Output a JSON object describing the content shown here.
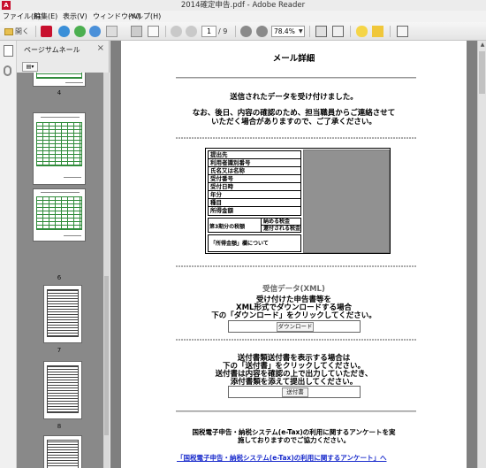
{
  "window": {
    "title": "2014確定申告.pdf - Adobe Reader",
    "app_icon": "adobe-reader-icon"
  },
  "menu": [
    "ファイル(F)",
    "編集(E)",
    "表示(V)",
    "ウィンドウ(W)",
    "ヘルプ(H)"
  ],
  "toolbar": {
    "open_label": "開く",
    "page_current": "1",
    "page_total": "/ 9",
    "zoom": "78.4%"
  },
  "sidebar": {
    "title": "ページサムネール",
    "close": "×",
    "thumb_labels": [
      "4",
      "5",
      "6",
      "7",
      "8"
    ]
  },
  "document": {
    "heading": "メール詳細",
    "received_line1": "送信されたデータを受け付けました。",
    "received_line2": "なお、後日、内容の確認のため、担当職員からご連絡させて",
    "received_line3": "いただく場合がありますので、ご了承ください。",
    "info_rows": [
      "提出先",
      "利用者識別番号",
      "氏名又は名称",
      "受付番号",
      "受付日時",
      "年分",
      "種目",
      "所得金額"
    ],
    "tax_label": "第3期分の税額",
    "tax_pay": "納める税金",
    "tax_refund": "還付される税金",
    "income_note": "「所得金額」欄について",
    "xml_title": "受信データ(XML)",
    "xml_line1": "受け付けた申告書等を",
    "xml_line2": "XML形式でダウンロードする場合",
    "xml_line3": "下の「ダウンロード」をクリックしてください。",
    "download_button": "ダウンロード",
    "sendslip_line1": "送付書類送付書を表示する場合は",
    "sendslip_line2": "下の「送付書」をクリックしてください。",
    "sendslip_line3": "送付書は内容を確認の上で出力していただき、",
    "sendslip_line4": "添付書類を添えて提出してください。",
    "sendslip_button": "送付書",
    "survey_line1": "国税電子申告・納税システム(e-Tax)の利用に関するアンケートを実",
    "survey_line2": "施しておりますのでご協力ください。",
    "survey_link": "「国税電子申告・納税システム(e-Tax)の利用に関するアンケート」へ"
  }
}
